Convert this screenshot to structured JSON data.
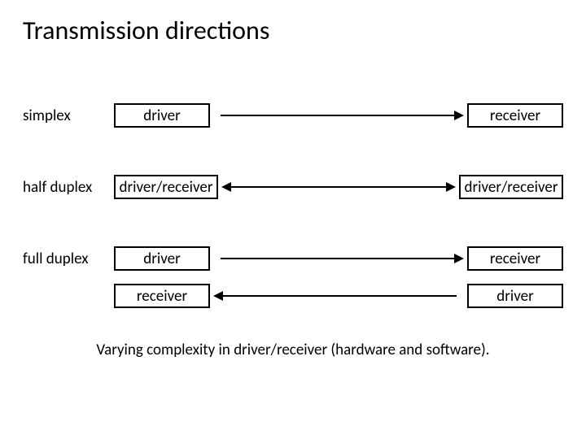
{
  "title": "Transmission directions",
  "rows": {
    "simplex": {
      "label": "simplex",
      "left": "driver",
      "right": "receiver"
    },
    "half_duplex": {
      "label": "half duplex",
      "left": "driver/receiver",
      "right": "driver/receiver"
    },
    "full_duplex": {
      "label": "full duplex",
      "line1": {
        "left": "driver",
        "right": "receiver"
      },
      "line2": {
        "left": "receiver",
        "right": "driver"
      }
    }
  },
  "caption": "Varying complexity in driver/receiver (hardware and software).",
  "chart_data": {
    "type": "table",
    "title": "Transmission directions",
    "rows": [
      {
        "mode": "simplex",
        "left_node": "driver",
        "right_node": "receiver",
        "direction": "left-to-right"
      },
      {
        "mode": "half duplex",
        "left_node": "driver/receiver",
        "right_node": "driver/receiver",
        "direction": "bidirectional"
      },
      {
        "mode": "full duplex",
        "left_node": "driver",
        "right_node": "receiver",
        "direction": "left-to-right"
      },
      {
        "mode": "full duplex",
        "left_node": "receiver",
        "right_node": "driver",
        "direction": "right-to-left"
      }
    ]
  }
}
